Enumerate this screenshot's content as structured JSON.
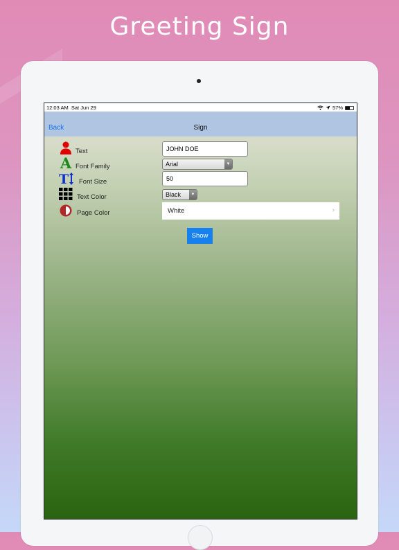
{
  "marketing": {
    "title": "Greeting Sign"
  },
  "status_bar": {
    "time": "12:03 AM",
    "date": "Sat Jun 29",
    "battery": "57%",
    "battery_level": 0.57
  },
  "nav": {
    "back_label": "Back",
    "title": "Sign"
  },
  "form": {
    "text": {
      "label": "Text",
      "value": "JOHN DOE",
      "icon": "person-icon",
      "icon_color": "#e00000"
    },
    "font_family": {
      "label": "Font Family",
      "value": "Arial",
      "icon": "letter-a-icon",
      "icon_color": "#1a8a1a"
    },
    "font_size": {
      "label": "Font Size",
      "value": "50",
      "icon": "text-size-icon",
      "icon_color": "#1030c8"
    },
    "text_color": {
      "label": "Text Color",
      "value": "Black",
      "icon": "grid-icon",
      "icon_color": "#000000"
    },
    "page_color": {
      "label": "Page Color",
      "value": "White",
      "icon": "half-circle-icon",
      "icon_color": "#b02828"
    }
  },
  "show_button": {
    "label": "Show",
    "color": "#1580ee"
  }
}
